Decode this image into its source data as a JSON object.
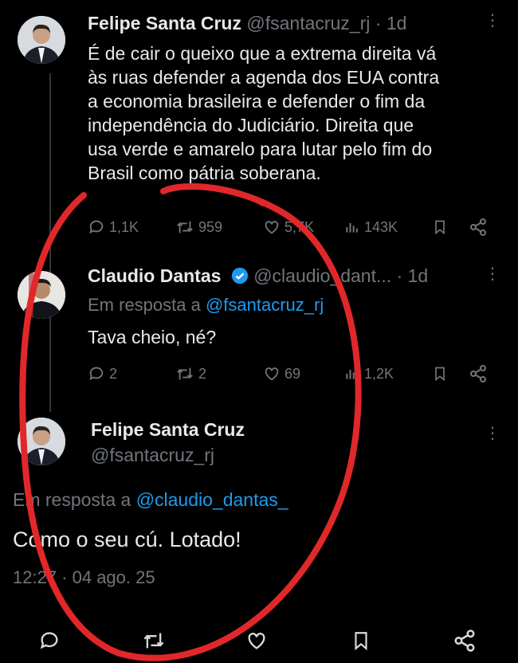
{
  "tweet1": {
    "name": "Felipe Santa Cruz",
    "handle": "@fsantacruz_rj",
    "time": "· 1d",
    "lines": [
      "É de cair o queixo que a extrema direita vá",
      "às ruas defender a agenda dos EUA contra",
      "a economia brasileira e defender o fim da",
      "independência do Judiciário. Direita que",
      "usa verde e amarelo para lutar pelo fim do",
      "Brasil como pátria soberana."
    ],
    "replies": "1,1K",
    "retweets": "959",
    "likes": "5,7K",
    "views": "143K"
  },
  "tweet2": {
    "name": "Claudio Dantas",
    "handle": "@claudio_dant...",
    "time": "· 1d",
    "reply_prefix": "Em resposta a",
    "reply_mention": "@fsantacruz_rj",
    "text": "Tava cheio, né?",
    "replies": "2",
    "retweets": "2",
    "likes": "69",
    "views": "1,2K"
  },
  "tweet3": {
    "name": "Felipe Santa Cruz",
    "handle": "@fsantacruz_rj",
    "reply_prefix": "Em resposta a",
    "reply_mention": "@claudio_dantas_",
    "text": "Como o seu cú. Lotado!",
    "timestamp": "12:27 · 04 ago. 25"
  },
  "colors": {
    "background": "#000000",
    "text": "#e7e9ea",
    "muted": "#71767b",
    "link": "#1d9bf0",
    "annotation": "#e0282b"
  }
}
